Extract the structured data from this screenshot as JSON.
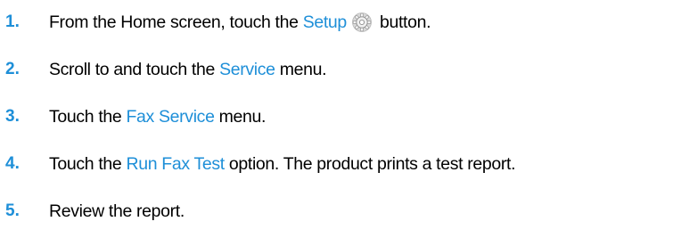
{
  "colors": {
    "accent": "#1e8fd8",
    "text": "#000000"
  },
  "steps": [
    {
      "number": "1.",
      "before": "From the Home screen, touch the ",
      "term": "Setup",
      "icon": "gear-icon",
      "after": " button."
    },
    {
      "number": "2.",
      "before": "Scroll to and touch the ",
      "term": "Service",
      "after": " menu."
    },
    {
      "number": "3.",
      "before": "Touch the ",
      "term": "Fax Service",
      "after": " menu."
    },
    {
      "number": "4.",
      "before": "Touch the ",
      "term": "Run Fax Test",
      "after": " option. The product prints a test report."
    },
    {
      "number": "5.",
      "text": "Review the report."
    }
  ]
}
